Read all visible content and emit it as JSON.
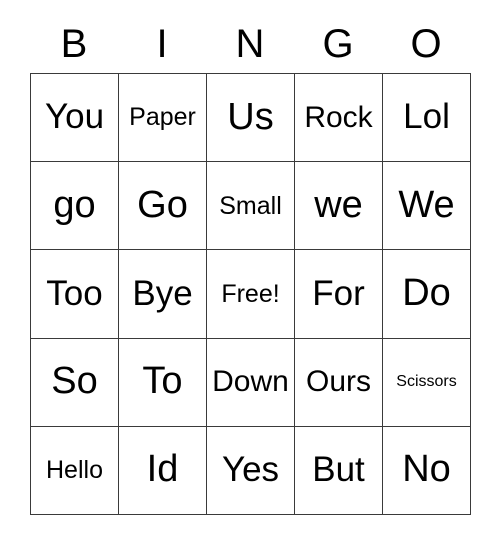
{
  "card": {
    "title": "BINGO",
    "header_letters": [
      "B",
      "I",
      "N",
      "G",
      "O"
    ],
    "free_space_text": "Free!",
    "grid_size": "5x5",
    "colors": {
      "background": "#ffffff",
      "border": "#3a3a3a",
      "text": "#000000"
    },
    "rows": [
      [
        {
          "text": "You",
          "size": "sz-lg"
        },
        {
          "text": "Paper",
          "size": "sz-sm"
        },
        {
          "text": "Us",
          "size": "sz-xl"
        },
        {
          "text": "Rock",
          "size": "sz-md"
        },
        {
          "text": "Lol",
          "size": "sz-lg"
        }
      ],
      [
        {
          "text": "go",
          "size": "sz-xl"
        },
        {
          "text": "Go",
          "size": "sz-xl"
        },
        {
          "text": "Small",
          "size": "sz-sm"
        },
        {
          "text": "we",
          "size": "sz-xl"
        },
        {
          "text": "We",
          "size": "sz-xl"
        }
      ],
      [
        {
          "text": "Too",
          "size": "sz-lg"
        },
        {
          "text": "Bye",
          "size": "sz-lg"
        },
        {
          "text": "Free!",
          "size": "sz-sm"
        },
        {
          "text": "For",
          "size": "sz-lg"
        },
        {
          "text": "Do",
          "size": "sz-xl"
        }
      ],
      [
        {
          "text": "So",
          "size": "sz-xl"
        },
        {
          "text": "To",
          "size": "sz-xl"
        },
        {
          "text": "Down",
          "size": "sz-md"
        },
        {
          "text": "Ours",
          "size": "sz-md"
        },
        {
          "text": "Scissors",
          "size": "sz-xs"
        }
      ],
      [
        {
          "text": "Hello",
          "size": "sz-sm"
        },
        {
          "text": "Id",
          "size": "sz-xl"
        },
        {
          "text": "Yes",
          "size": "sz-lg"
        },
        {
          "text": "But",
          "size": "sz-lg"
        },
        {
          "text": "No",
          "size": "sz-xl"
        }
      ]
    ]
  }
}
